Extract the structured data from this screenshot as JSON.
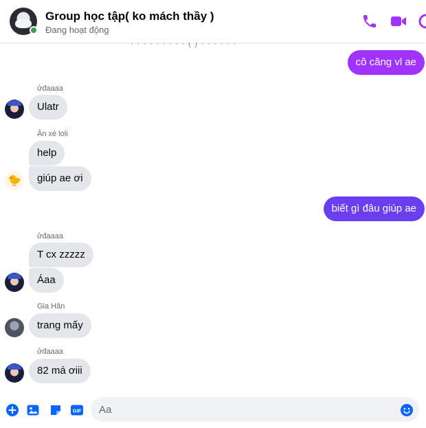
{
  "header": {
    "title": "Group học tập( ko mách thầy )",
    "status": "Đang hoạt động",
    "icons": [
      "phone-icon",
      "video-icon",
      "info-icon"
    ]
  },
  "colors": {
    "accent": "#a033ff",
    "accent_blue": "#6b3ef0",
    "incoming_bubble": "#e4e6eb",
    "online": "#31a24c"
  },
  "thread": {
    "cutoff_text": "· · · · · · · · · ( ) · · · · · ·",
    "messages": [
      {
        "dir": "out",
        "text": "cô căng vl ae"
      },
      {
        "sender": "ửđaaaa",
        "dir": "in",
        "text": "Ulatr"
      },
      {
        "sender": "Ăn xé loli",
        "dir": "in",
        "text": "help"
      },
      {
        "dir": "in",
        "text": "giúp ae ơi"
      },
      {
        "dir": "out",
        "text": "biết gì đâu giúp ae"
      },
      {
        "sender": "ửđaaaa",
        "dir": "in",
        "text": "T cx zzzzz"
      },
      {
        "dir": "in",
        "text": "Áaa"
      },
      {
        "sender": "Gia Hân",
        "dir": "in",
        "text": "trang mấy"
      },
      {
        "sender": "ửđaaaa",
        "dir": "in",
        "text": "82 má ơiii"
      }
    ]
  },
  "composer": {
    "placeholder": "Aa",
    "icons": [
      "plus-circle-icon",
      "image-icon",
      "sticker-icon",
      "gif-icon",
      "emoji-icon"
    ],
    "gif_label": "GIF"
  }
}
